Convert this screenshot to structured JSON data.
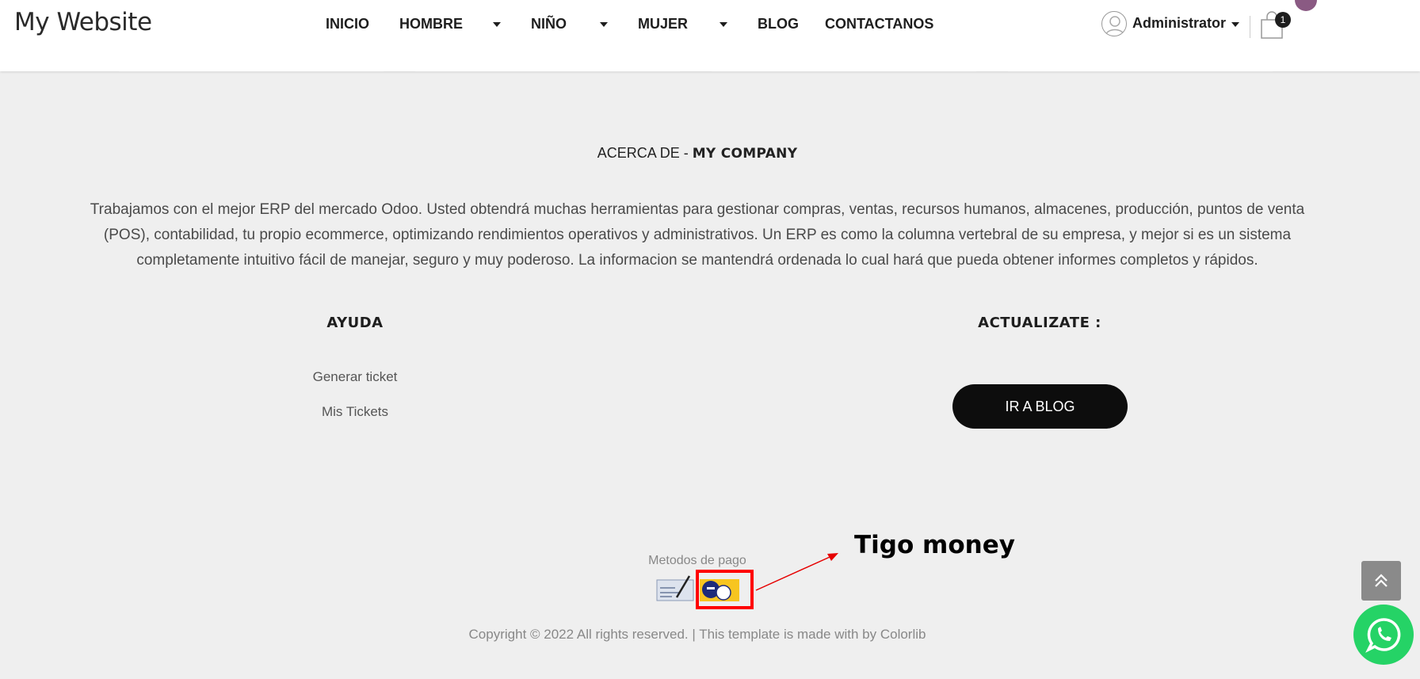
{
  "header": {
    "brand": "My Website",
    "nav": [
      {
        "label": "INICIO"
      },
      {
        "label": "HOMBRE"
      },
      {
        "label": "NIÑO"
      },
      {
        "label": "MUJER"
      },
      {
        "label": "BLOG"
      },
      {
        "label": "CONTACTANOS"
      }
    ],
    "user_name": "Administrator",
    "cart_count": "1"
  },
  "about": {
    "title_prefix": "ACERCA DE - ",
    "title_company": "MY COMPANY",
    "text": "Trabajamos con el mejor ERP del mercado Odoo. Usted obtendrá muchas herramientas para gestionar compras, ventas, recursos humanos, almacenes, producción, puntos de venta (POS), contabilidad, tu propio ecommerce, optimizando rendimientos operativos y administrativos. Un ERP es como la columna vertebral de su empresa, y mejor si es un sistema completamente intuitivo fácil de manejar, seguro y muy poderoso. La informacion se mantendrá ordenada lo cual hará que pueda obtener informes completos y rápidos."
  },
  "help": {
    "title": "AYUDA",
    "links": [
      "Generar ticket",
      "Mis Tickets"
    ]
  },
  "update": {
    "title": "ACTUALIZATE :",
    "button": "IR A BLOG"
  },
  "payment": {
    "label": "Metodos de pago",
    "annotation": "Tigo money"
  },
  "footer": {
    "copyright": "Copyright © 2022 All rights reserved. | This template is made with by Colorlib"
  },
  "colors": {
    "annotation_red": "#ff0000",
    "whatsapp_green": "#25d366",
    "button_dark": "#0d0d0d"
  }
}
